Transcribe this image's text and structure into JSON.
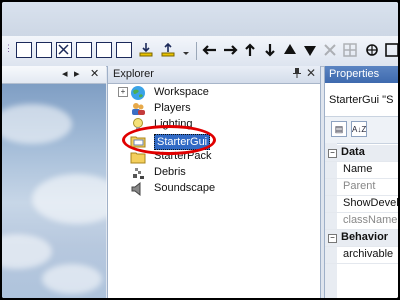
{
  "left_panel": {
    "nav_prev": "◂",
    "nav_next": "▸",
    "close": "✕"
  },
  "explorer": {
    "title": "Explorer",
    "pin": "📌",
    "close": "✕",
    "expander": "+",
    "items": [
      {
        "label": "Workspace",
        "icon": "globe-icon"
      },
      {
        "label": "Players",
        "icon": "players-icon"
      },
      {
        "label": "Lighting",
        "icon": "lightbulb-icon"
      },
      {
        "label": "StarterGui",
        "icon": "folder-gui-icon"
      },
      {
        "label": "StarterPack",
        "icon": "backpack-icon"
      },
      {
        "label": "Debris",
        "icon": "debris-icon"
      },
      {
        "label": "Soundscape",
        "icon": "speaker-icon"
      }
    ],
    "selected": "StarterGui"
  },
  "properties": {
    "title": "Properties",
    "subtitle": "StarterGui \"S",
    "sort_categorized": "▤",
    "sort_alpha": "A↓Z",
    "sections": [
      {
        "name": "Data",
        "rows": [
          "Name",
          "Parent",
          "ShowDevel",
          "className"
        ]
      },
      {
        "name": "Behavior",
        "rows": [
          "archivable"
        ]
      }
    ],
    "collapse_glyph": "−"
  },
  "colors": {
    "selection": "#316ac5",
    "highlight_ring": "#e00000",
    "title_bar": "#3e6aae"
  }
}
